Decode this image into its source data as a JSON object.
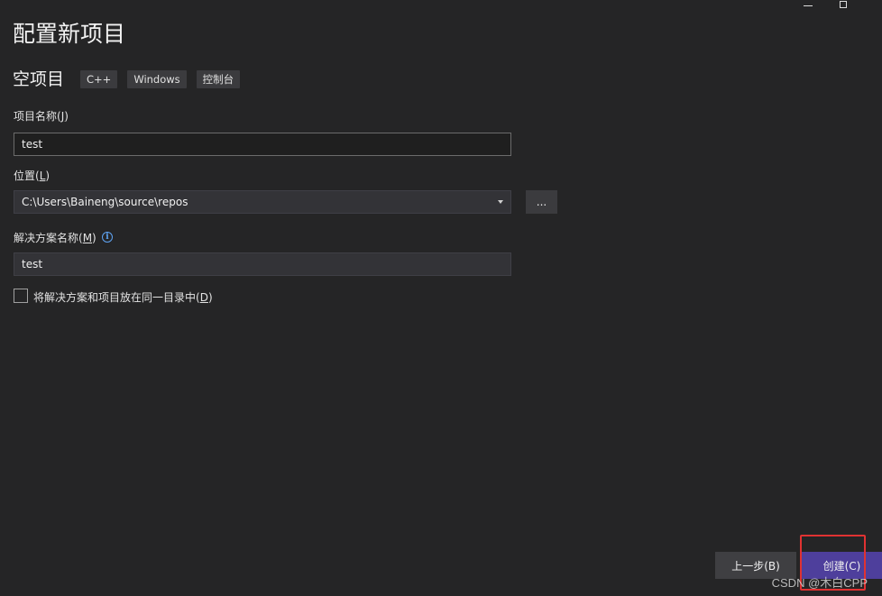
{
  "window": {
    "minimize_icon": "minimize-icon",
    "maximize_icon": "maximize-icon"
  },
  "page": {
    "title": "配置新项目"
  },
  "template": {
    "name": "空项目",
    "tags": [
      "C++",
      "Windows",
      "控制台"
    ]
  },
  "project_name": {
    "label": "项目名称(",
    "mnemonic": "J",
    "label_end": ")",
    "value": "test"
  },
  "location": {
    "label": "位置(",
    "mnemonic": "L",
    "label_end": ")",
    "value": "C:\\Users\\Baineng\\source\\repos",
    "browse_label": "..."
  },
  "solution_name": {
    "label": "解决方案名称(",
    "mnemonic": "M",
    "label_end": ")",
    "value": "test",
    "info_icon": "info-icon"
  },
  "same_dir": {
    "label": "将解决方案和项目放在同一目录中(",
    "mnemonic": "D",
    "label_end": ")",
    "checked": false
  },
  "buttons": {
    "back": "上一步(B)",
    "create": "创建(C)"
  },
  "watermark": "CSDN @木白CPP",
  "colors": {
    "background": "#252526",
    "create_button": "#4e3f9c",
    "highlight": "#e03232",
    "info": "#5ea3f2"
  }
}
